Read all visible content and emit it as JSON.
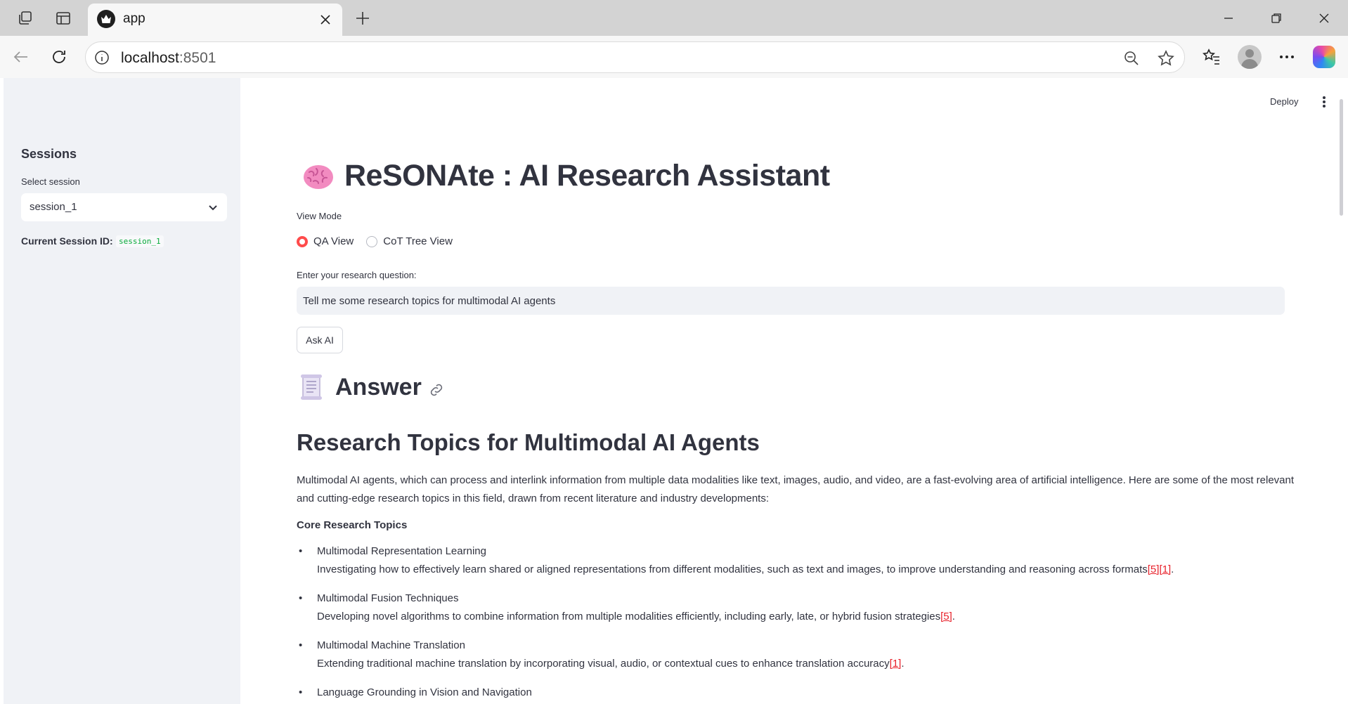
{
  "browser": {
    "tab_title": "app",
    "url_host": "localhost",
    "url_port": ":8501"
  },
  "header": {
    "deploy_label": "Deploy"
  },
  "sidebar": {
    "title": "Sessions",
    "select_label": "Select session",
    "selected_session": "session_1",
    "current_id_label": "Current Session ID:",
    "current_id_value": "session_1"
  },
  "main": {
    "title": "ReSONAte : AI Research Assistant",
    "view_mode": {
      "label": "View Mode",
      "options": [
        "QA View",
        "CoT Tree View"
      ],
      "selected": "QA View"
    },
    "question": {
      "label": "Enter your research question:",
      "value": "Tell me some research topics for multimodal AI agents"
    },
    "ask_button": "Ask AI",
    "answer_heading": "Answer",
    "answer": {
      "title": "Research Topics for Multimodal AI Agents",
      "intro": "Multimodal AI agents, which can process and interlink information from multiple data modalities like text, images, audio, and video, are a fast-evolving area of artificial intelligence. Here are some of the most relevant and cutting-edge research topics in this field, drawn from recent literature and industry developments:",
      "section": "Core Research Topics",
      "items": [
        {
          "title": "Multimodal Representation Learning",
          "desc": "Investigating how to effectively learn shared or aligned representations from different modalities, such as text and images, to improve understanding and reasoning across formats",
          "cites": [
            "[5]",
            "[1]"
          ]
        },
        {
          "title": "Multimodal Fusion Techniques",
          "desc": "Developing novel algorithms to combine information from multiple modalities efficiently, including early, late, or hybrid fusion strategies",
          "cites": [
            "[5]"
          ]
        },
        {
          "title": "Multimodal Machine Translation",
          "desc": "Extending traditional machine translation by incorporating visual, audio, or contextual cues to enhance translation accuracy",
          "cites": [
            "[1]"
          ]
        },
        {
          "title": "Language Grounding in Vision and Navigation",
          "desc": "",
          "cites": []
        }
      ]
    }
  },
  "colors": {
    "accent": "#ff4b4b",
    "sidebar_bg": "#f0f2f6",
    "text": "#31333f",
    "code_green": "#09ab3b",
    "citation": "#e8202a"
  },
  "icons": [
    "workspaces-icon",
    "tab-actions-icon",
    "app-favicon-icon",
    "close-tab-icon",
    "new-tab-icon",
    "minimize-icon",
    "restore-icon",
    "close-window-icon",
    "back-icon",
    "refresh-icon",
    "site-info-icon",
    "zoom-out-icon",
    "favorite-star-icon",
    "favorites-icon",
    "profile-icon",
    "more-icon",
    "copilot-icon",
    "chevron-down-icon",
    "kebab-menu-icon",
    "brain-icon",
    "scroll-icon",
    "link-icon"
  ]
}
